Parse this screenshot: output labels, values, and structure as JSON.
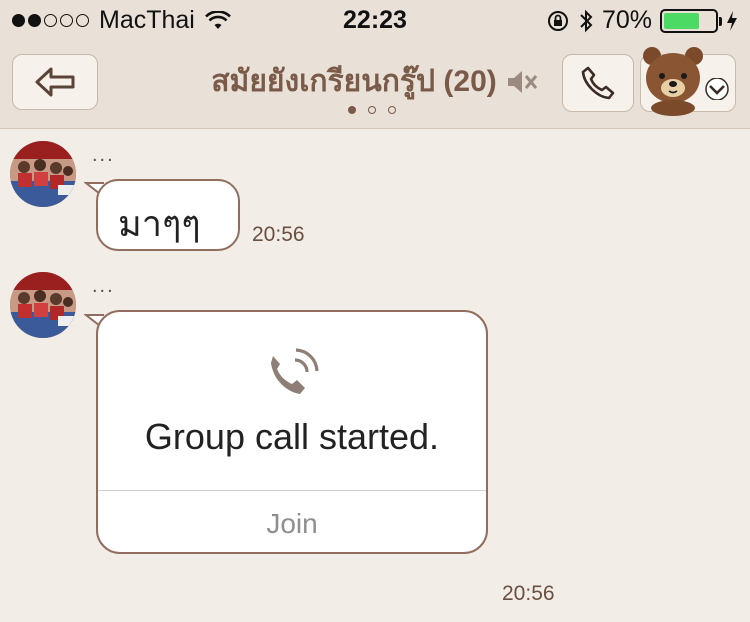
{
  "status_bar": {
    "carrier": "MacThai",
    "time": "22:23",
    "battery": "70%",
    "battery_level": 0.7
  },
  "header": {
    "title": "สมัยยังเกรียนกรู๊ป (20)"
  },
  "messages": [
    {
      "sender": "...",
      "text": "มาๆๆ",
      "time": "20:56"
    },
    {
      "sender": "...",
      "card": {
        "title": "Group call started.",
        "action": "Join"
      },
      "time": "20:56"
    }
  ],
  "colors": {
    "accent": "#7a5a48",
    "background": "#f2ede6",
    "battery": "#4cd964"
  }
}
